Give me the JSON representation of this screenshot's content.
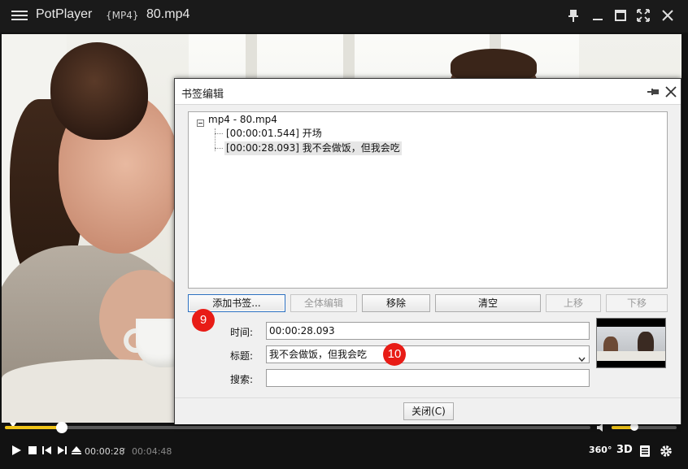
{
  "app": {
    "name": "PotPlayer",
    "format_tag": "{MP4}",
    "file_name": "80.mp4"
  },
  "window_controls": [
    "pin-icon",
    "minimize-icon",
    "maximize-icon",
    "fullscreen-icon",
    "close-icon"
  ],
  "playback": {
    "current_time": "00:00:28",
    "separator": "/",
    "total_time": "00:04:48",
    "progress_fraction": 0.097,
    "volume_fraction": 0.35,
    "badge_360": "360°",
    "badge_3d": "3D"
  },
  "dialog": {
    "title": "书签编辑",
    "tree": {
      "root": "mp4 - 80.mp4",
      "items": [
        {
          "label": "[00:00:01.544] 开场",
          "selected": false
        },
        {
          "label": "[00:00:28.093] 我不会做饭，但我会吃",
          "selected": true
        }
      ]
    },
    "buttons": {
      "add": "添加书签...",
      "edit_all": "全体编辑",
      "remove": "移除",
      "clear": "清空",
      "move_up": "上移",
      "move_down": "下移",
      "close": "关闭(C)"
    },
    "fields": {
      "time_label": "时间:",
      "time_value": "00:00:28.093",
      "title_label": "标题:",
      "title_value": "我不会做饭，但我会吃",
      "search_label": "搜索:",
      "search_value": ""
    }
  },
  "markers": [
    "9",
    "10"
  ],
  "colors": {
    "accent": "#f0c419",
    "marker": "#e81c16",
    "titlebar": "#1a1a1a"
  }
}
